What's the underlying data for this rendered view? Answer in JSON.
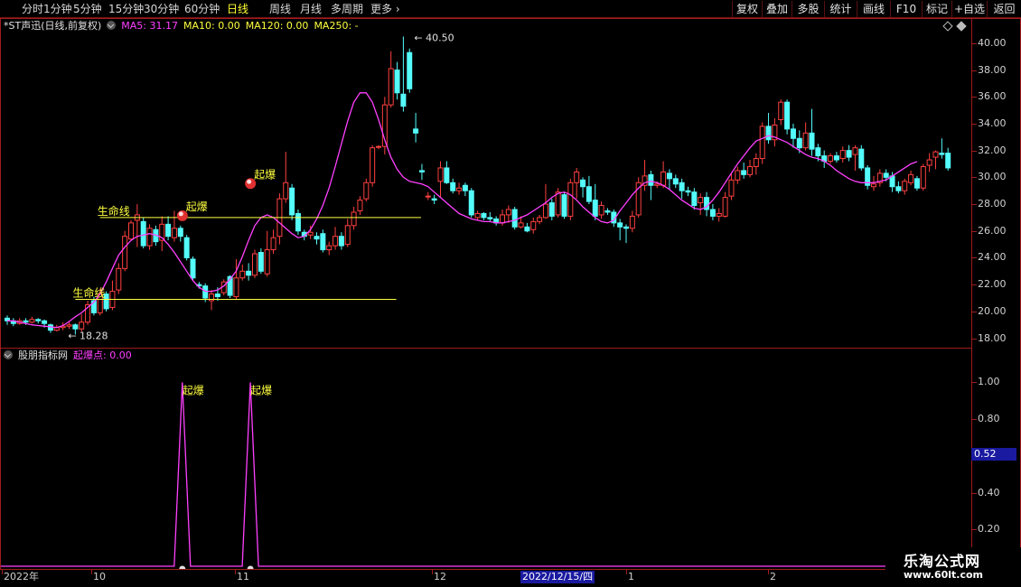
{
  "toolbar": {
    "periods": [
      "分时",
      "1分钟",
      "5分钟",
      "15分钟",
      "30分钟",
      "60分钟",
      "日线",
      "周线",
      "月线",
      "多周期",
      "更多"
    ],
    "active_period": "日线",
    "right_buttons": [
      "复权",
      "叠加",
      "多股",
      "统计",
      "画线",
      "F10",
      "标记",
      "+自选",
      "返回"
    ]
  },
  "main_panel": {
    "title": "*ST声迅(日线,前复权)",
    "ma5_label": "MA5: 31.17",
    "ma10_label": "MA10: 0.00",
    "ma120_label": "MA120: 0.00",
    "ma250_label": "MA250: -",
    "high_label": "40.50",
    "low_label": "18.28",
    "lifeline_upper_label": "生命线",
    "lifeline_lower_label": "生命线",
    "signal_labels": [
      "起爆",
      "起爆"
    ]
  },
  "sub_panel": {
    "title": "股朋指标网",
    "indicator_label": "起爆点: 0.00",
    "peak_labels": [
      "起爆",
      "起爆"
    ],
    "cursor_value": "0.52"
  },
  "date_axis": {
    "labels": [
      "2022年",
      "10",
      "11",
      "12",
      "1",
      "2"
    ],
    "cursor_date": "2022/12/15/四"
  },
  "watermark": {
    "line1": "乐淘公式网",
    "line2": "www.60lt.com"
  },
  "colors": {
    "up": "#ff4040",
    "down": "#54fcfc",
    "ma5": "#ff40ff",
    "lifeline": "#ffff40",
    "active": "#ffff33",
    "border": "#a01c1c"
  },
  "chart_data": [
    {
      "type": "candlestick",
      "title": "*ST声迅(日线,前复权)",
      "ylim": [
        17.5,
        41.2
      ],
      "y_ticks": [
        "18.00",
        "20.00",
        "22.00",
        "24.00",
        "26.00",
        "28.00",
        "30.00",
        "32.00",
        "34.00",
        "36.00",
        "38.00",
        "40.00"
      ],
      "candles": [
        [
          19.5,
          19.3,
          19.7,
          19.0
        ],
        [
          19.3,
          19.1,
          19.5,
          18.9
        ],
        [
          19.1,
          19.3,
          19.5,
          19.0
        ],
        [
          19.3,
          19.2,
          19.5,
          19.0
        ],
        [
          19.2,
          19.4,
          19.6,
          19.1
        ],
        [
          19.4,
          19.3,
          19.5,
          19.1
        ],
        [
          19.3,
          19.1,
          19.4,
          18.8
        ],
        [
          19.0,
          18.6,
          19.1,
          18.4
        ],
        [
          18.6,
          18.8,
          19.0,
          18.5
        ],
        [
          18.8,
          18.9,
          19.2,
          18.6
        ],
        [
          18.9,
          19.0,
          19.2,
          18.7
        ],
        [
          19.0,
          18.7,
          19.1,
          18.28
        ],
        [
          18.7,
          19.2,
          19.8,
          18.5
        ],
        [
          19.2,
          20.5,
          20.8,
          19.0
        ],
        [
          20.8,
          19.9,
          21.1,
          19.7
        ],
        [
          19.9,
          21.3,
          21.7,
          19.7
        ],
        [
          21.3,
          20.2,
          21.5,
          20.0
        ],
        [
          20.3,
          21.5,
          22.3,
          20.1
        ],
        [
          21.6,
          23.2,
          23.6,
          21.3
        ],
        [
          23.2,
          25.6,
          26.0,
          23.0
        ],
        [
          25.4,
          26.6,
          26.8,
          25.3
        ],
        [
          26.8,
          27.2,
          28.0,
          24.8
        ],
        [
          26.7,
          24.9,
          27.0,
          24.7
        ],
        [
          24.9,
          26.2,
          26.5,
          24.6
        ],
        [
          26.1,
          25.2,
          26.4,
          24.9
        ],
        [
          25.3,
          26.5,
          27.1,
          24.5
        ],
        [
          26.5,
          25.6,
          27.1,
          25.3
        ],
        [
          25.5,
          26.2,
          27.5,
          25.2
        ],
        [
          26.2,
          25.6,
          26.4,
          25.2
        ],
        [
          25.5,
          24.0,
          25.7,
          23.8
        ],
        [
          23.9,
          22.5,
          24.1,
          22.3
        ],
        [
          22.0,
          21.9,
          22.2,
          21.7
        ],
        [
          21.9,
          21.0,
          22.1,
          20.7
        ],
        [
          20.8,
          21.3,
          21.6,
          20.1
        ],
        [
          21.3,
          21.1,
          21.8,
          20.8
        ],
        [
          21.4,
          22.2,
          22.4,
          21.2
        ],
        [
          22.6,
          21.2,
          22.7,
          21.0
        ],
        [
          21.1,
          22.5,
          23.9,
          20.9
        ],
        [
          22.5,
          23.0,
          23.5,
          22.3
        ],
        [
          23.0,
          22.7,
          23.6,
          22.3
        ],
        [
          22.7,
          24.3,
          24.6,
          22.5
        ],
        [
          24.4,
          23.0,
          24.7,
          22.8
        ],
        [
          22.8,
          24.6,
          26.0,
          22.6
        ],
        [
          24.6,
          25.5,
          26.1,
          24.3
        ],
        [
          25.6,
          28.4,
          28.8,
          25.0
        ],
        [
          28.4,
          29.6,
          31.9,
          28.1
        ],
        [
          29.2,
          27.2,
          29.5,
          26.8
        ],
        [
          27.3,
          26.0,
          27.6,
          25.7
        ],
        [
          25.9,
          25.6,
          26.1,
          25.3
        ],
        [
          25.7,
          25.9,
          26.4,
          25.4
        ],
        [
          25.6,
          25.4,
          25.9,
          25.0
        ],
        [
          25.8,
          24.6,
          26.1,
          24.4
        ],
        [
          24.6,
          24.9,
          25.2,
          24.2
        ],
        [
          24.9,
          25.6,
          26.3,
          24.6
        ],
        [
          25.6,
          24.9,
          25.9,
          24.6
        ],
        [
          25.0,
          26.4,
          26.9,
          24.8
        ],
        [
          26.4,
          27.4,
          27.8,
          26.1
        ],
        [
          27.5,
          28.3,
          28.6,
          27.2
        ],
        [
          28.4,
          29.6,
          29.9,
          28.2
        ],
        [
          29.6,
          32.2,
          32.4,
          29.3
        ],
        [
          32.3,
          32.3,
          32.4,
          32.1
        ],
        [
          32.3,
          35.4,
          36.0,
          31.7
        ],
        [
          35.4,
          38.1,
          39.4,
          35.2
        ],
        [
          38.0,
          36.3,
          38.6,
          35.8
        ],
        [
          36.2,
          35.3,
          40.5,
          34.9
        ],
        [
          39.3,
          36.6,
          39.6,
          36.3
        ],
        [
          33.6,
          33.3,
          34.8,
          32.6
        ],
        [
          30.5,
          30.4,
          31.0,
          29.8
        ],
        [
          28.6,
          28.6,
          28.9,
          28.3
        ],
        [
          28.4,
          28.3,
          28.7,
          28.0
        ],
        [
          29.7,
          30.7,
          31.2,
          28.5
        ],
        [
          30.7,
          29.6,
          31.2,
          29.5
        ],
        [
          29.6,
          29.0,
          29.9,
          28.8
        ],
        [
          29.0,
          29.2,
          29.6,
          28.7
        ],
        [
          29.4,
          29.0,
          29.6,
          28.6
        ],
        [
          29.0,
          27.2,
          29.2,
          27.0
        ],
        [
          27.0,
          27.3,
          27.5,
          26.8
        ],
        [
          27.3,
          27.0,
          27.4,
          26.8
        ],
        [
          27.0,
          26.9,
          27.4,
          26.7
        ],
        [
          26.9,
          26.6,
          27.1,
          26.4
        ],
        [
          26.6,
          27.2,
          27.6,
          26.4
        ],
        [
          27.2,
          27.6,
          27.9,
          26.6
        ],
        [
          27.6,
          26.3,
          27.8,
          26.1
        ],
        [
          26.3,
          26.6,
          27.1,
          26.2
        ],
        [
          26.3,
          26.0,
          26.6,
          25.9
        ],
        [
          26.1,
          26.7,
          27.0,
          25.8
        ],
        [
          26.7,
          27.0,
          27.2,
          26.5
        ],
        [
          27.0,
          28.0,
          29.5,
          26.9
        ],
        [
          28.1,
          27.1,
          28.4,
          26.8
        ],
        [
          27.2,
          28.9,
          29.2,
          27.0
        ],
        [
          28.7,
          27.1,
          28.9,
          26.9
        ],
        [
          27.1,
          29.6,
          29.9,
          26.8
        ],
        [
          29.6,
          30.4,
          30.7,
          28.4
        ],
        [
          29.8,
          29.3,
          30.0,
          28.5
        ],
        [
          29.3,
          28.2,
          30.1,
          28.0
        ],
        [
          28.3,
          27.1,
          29.5,
          26.8
        ],
        [
          27.2,
          27.9,
          28.2,
          26.9
        ],
        [
          27.5,
          27.4,
          27.7,
          27.2
        ],
        [
          27.4,
          26.6,
          27.6,
          26.3
        ],
        [
          26.6,
          26.3,
          26.9,
          25.3
        ],
        [
          26.3,
          26.2,
          26.5,
          25.1
        ],
        [
          26.2,
          27.1,
          27.5,
          25.9
        ],
        [
          27.2,
          29.6,
          30.0,
          27.0
        ],
        [
          29.4,
          30.1,
          31.3,
          29.0
        ],
        [
          30.2,
          29.4,
          30.5,
          28.3
        ],
        [
          29.4,
          29.5,
          29.7,
          29.2
        ],
        [
          29.4,
          30.4,
          31.2,
          29.2
        ],
        [
          30.3,
          29.9,
          30.6,
          29.1
        ],
        [
          29.9,
          29.5,
          30.2,
          29.2
        ],
        [
          29.6,
          29.0,
          29.9,
          28.4
        ],
        [
          29.0,
          28.9,
          29.3,
          28.6
        ],
        [
          28.9,
          27.9,
          29.2,
          27.6
        ],
        [
          28.1,
          28.5,
          28.8,
          27.2
        ],
        [
          28.5,
          27.6,
          28.9,
          27.1
        ],
        [
          27.6,
          27.1,
          28.0,
          26.8
        ],
        [
          27.1,
          27.3,
          27.7,
          26.7
        ],
        [
          27.1,
          28.5,
          28.9,
          27.0
        ],
        [
          28.6,
          29.8,
          30.3,
          28.3
        ],
        [
          29.8,
          30.5,
          30.8,
          29.5
        ],
        [
          30.5,
          30.2,
          31.1,
          29.9
        ],
        [
          30.2,
          30.8,
          31.3,
          30.0
        ],
        [
          30.8,
          31.4,
          31.8,
          30.2
        ],
        [
          31.4,
          33.8,
          34.1,
          31.0
        ],
        [
          33.8,
          32.8,
          34.8,
          32.5
        ],
        [
          32.8,
          33.9,
          34.4,
          32.3
        ],
        [
          34.3,
          35.6,
          35.8,
          33.9
        ],
        [
          35.6,
          33.6,
          35.8,
          33.2
        ],
        [
          33.6,
          32.9,
          34.0,
          32.2
        ],
        [
          32.9,
          32.2,
          33.5,
          31.8
        ],
        [
          32.2,
          33.3,
          34.1,
          32.0
        ],
        [
          33.3,
          32.1,
          35.1,
          31.6
        ],
        [
          32.2,
          31.6,
          32.5,
          31.2
        ],
        [
          31.6,
          31.2,
          32.0,
          30.7
        ],
        [
          31.2,
          31.6,
          31.8,
          31.0
        ],
        [
          31.6,
          31.3,
          31.9,
          31.1
        ],
        [
          31.4,
          32.0,
          32.3,
          31.1
        ],
        [
          32.0,
          31.5,
          32.4,
          31.2
        ],
        [
          31.7,
          32.2,
          32.4,
          30.5
        ],
        [
          32.1,
          30.7,
          32.4,
          30.5
        ],
        [
          30.7,
          29.4,
          30.9,
          29.1
        ],
        [
          29.3,
          29.5,
          30.1,
          29.0
        ],
        [
          29.6,
          30.3,
          30.6,
          29.3
        ],
        [
          30.3,
          30.0,
          30.6,
          29.7
        ],
        [
          30.1,
          29.3,
          30.4,
          28.9
        ],
        [
          29.3,
          29.0,
          29.7,
          28.8
        ],
        [
          29.0,
          29.7,
          29.9,
          28.7
        ],
        [
          29.6,
          30.2,
          30.5,
          29.4
        ],
        [
          29.9,
          29.2,
          30.1,
          29.0
        ],
        [
          29.2,
          30.8,
          31.0,
          29.0
        ],
        [
          30.9,
          31.3,
          31.8,
          30.4
        ],
        [
          31.5,
          31.9,
          32.0,
          30.6
        ],
        [
          31.8,
          31.7,
          32.9,
          31.4
        ],
        [
          31.8,
          30.7,
          32.2,
          30.5
        ]
      ],
      "ma5": [
        19.3,
        19.3,
        19.2,
        19.1,
        19.0,
        18.95,
        18.9,
        18.85,
        18.8,
        18.95,
        19.25,
        19.6,
        19.9,
        20.3,
        20.7,
        21.3,
        22.2,
        23.2,
        24.2,
        24.8,
        25.3,
        25.6,
        25.7,
        25.8,
        25.7,
        25.5,
        25.0,
        24.4,
        23.7,
        23.0,
        22.3,
        21.8,
        21.5,
        21.5,
        21.6,
        21.9,
        22.4,
        23.0,
        24.1,
        25.3,
        26.4,
        27.0,
        27.2,
        27.0,
        26.6,
        26.2,
        25.8,
        25.5,
        25.6,
        26.1,
        26.9,
        27.9,
        29.2,
        30.8,
        32.5,
        34.2,
        35.6,
        36.3,
        36.3,
        35.6,
        34.3,
        32.8,
        31.5,
        30.6,
        30.0,
        29.7,
        29.6,
        29.5,
        29.3,
        28.9,
        28.5,
        28.1,
        27.7,
        27.3,
        27.1,
        26.9,
        26.8,
        26.7,
        26.7,
        26.6,
        26.6,
        26.7,
        26.8,
        27.0,
        27.2,
        27.5,
        27.8,
        28.1,
        28.5,
        28.8,
        28.9,
        28.7,
        28.3,
        27.8,
        27.4,
        27.0,
        26.7,
        26.6,
        26.8,
        27.5,
        28.1,
        28.7,
        29.2,
        29.6,
        29.7,
        29.6,
        29.4,
        29.1,
        28.7,
        28.3,
        28.0,
        27.7,
        27.6,
        27.8,
        28.3,
        28.9,
        29.6,
        30.3,
        31.0,
        31.6,
        32.2,
        32.7,
        32.9,
        33.1,
        33.0,
        32.8,
        32.6,
        32.3,
        32.0,
        31.7,
        31.5,
        31.4,
        31.2,
        30.9,
        30.5,
        30.2,
        29.9,
        29.7,
        29.6,
        29.6,
        29.6,
        29.7,
        29.8,
        30.1,
        30.4,
        30.7,
        31.0,
        31.17
      ],
      "lifelines": [
        {
          "price": 27.0,
          "from_index": 15,
          "to_index": 47
        },
        {
          "price": 20.9,
          "from_index": 11,
          "to_index": 43
        }
      ],
      "signals": [
        {
          "index": 28,
          "price": 27.0
        },
        {
          "index": 39,
          "price": 29.4
        }
      ]
    },
    {
      "type": "line",
      "title": "起爆点",
      "ylim": [
        0,
        1.1
      ],
      "y_ticks": [
        "0.20",
        "0.40",
        "0.60",
        "0.80",
        "1.00"
      ],
      "peaks": [
        {
          "index": 28,
          "value": 1.0
        },
        {
          "index": 39,
          "value": 1.0
        }
      ]
    }
  ]
}
